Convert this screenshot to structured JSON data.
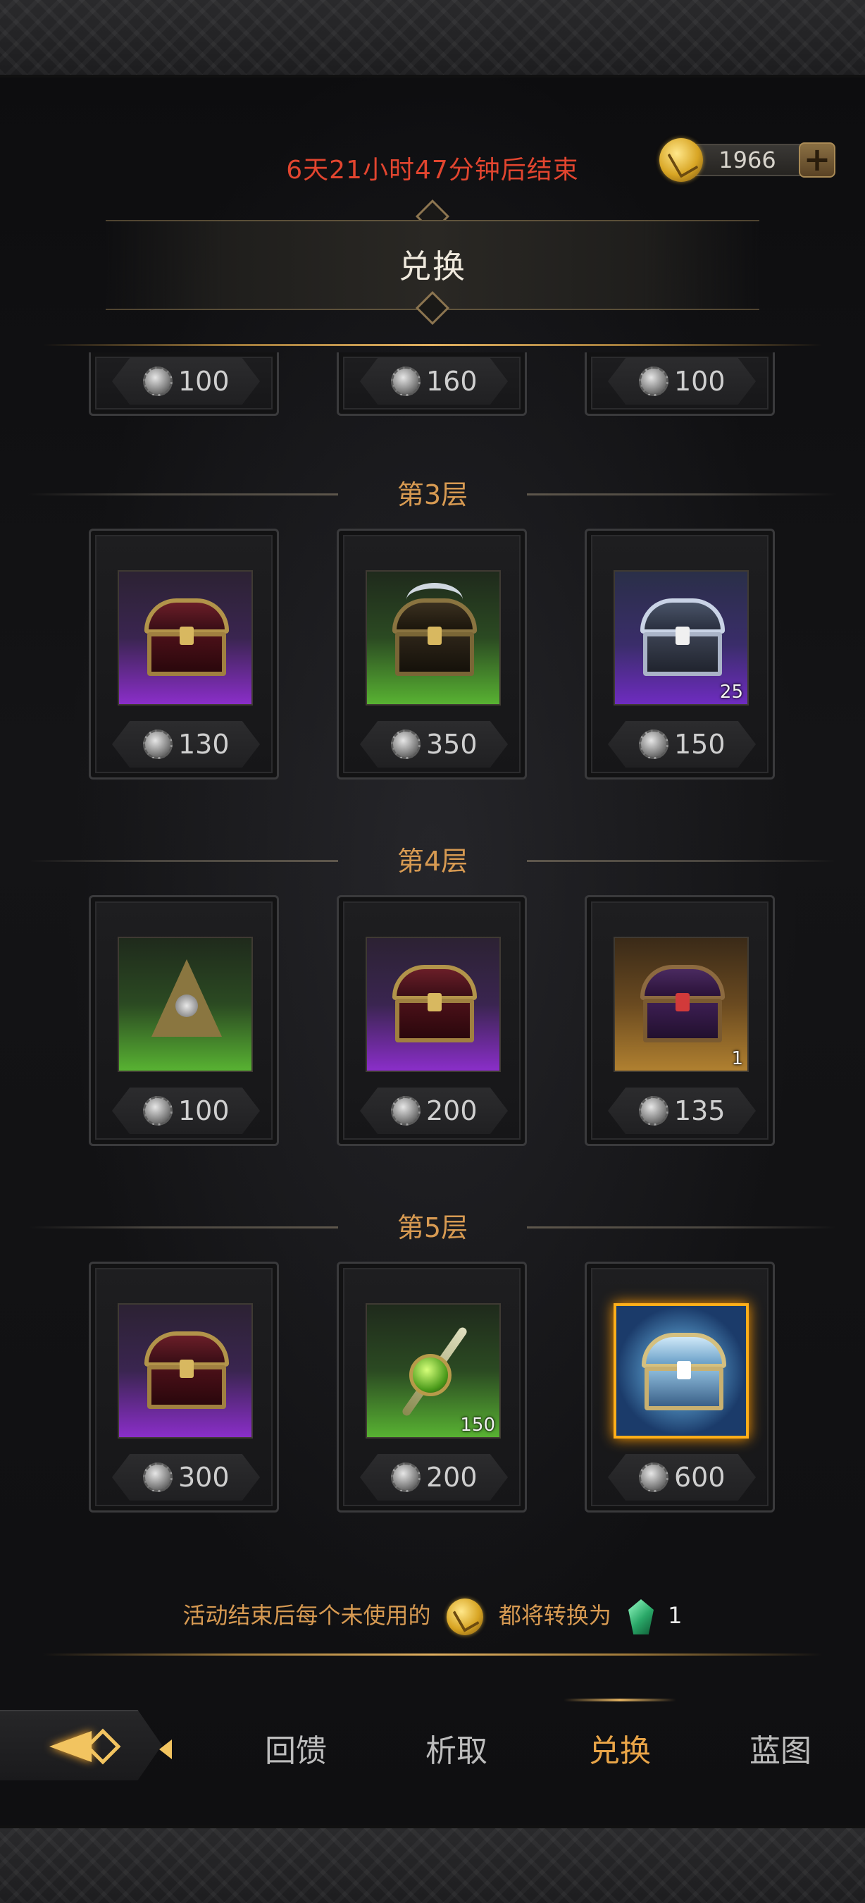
{
  "timer": "6天21小时47分钟后结束",
  "currency": {
    "value": "1966",
    "plus": "+",
    "icon": "gold-coin-icon"
  },
  "header": {
    "title": "兑换"
  },
  "top_row_prices": [
    "100",
    "160",
    "100"
  ],
  "tiers": [
    {
      "label": "第3层",
      "items": [
        {
          "name": "purple-chest",
          "rarity": "purple",
          "price": "130",
          "qty": ""
        },
        {
          "name": "spiky-chest",
          "rarity": "green",
          "price": "350",
          "qty": ""
        },
        {
          "name": "silver-chest",
          "rarity": "purple",
          "price": "150",
          "qty": "25"
        }
      ]
    },
    {
      "label": "第4层",
      "items": [
        {
          "name": "pyramid-relic",
          "rarity": "green",
          "price": "100",
          "qty": ""
        },
        {
          "name": "purple-chest",
          "rarity": "purple",
          "price": "200",
          "qty": ""
        },
        {
          "name": "dark-chest",
          "rarity": "gold",
          "price": "135",
          "qty": "1"
        }
      ]
    },
    {
      "label": "第5层",
      "items": [
        {
          "name": "purple-chest",
          "rarity": "purple",
          "price": "300",
          "qty": ""
        },
        {
          "name": "scepter",
          "rarity": "green",
          "price": "200",
          "qty": "150"
        },
        {
          "name": "ice-chest",
          "rarity": "legend",
          "price": "600",
          "qty": ""
        }
      ]
    }
  ],
  "notice": {
    "before": "活动结束后每个未使用的",
    "after": "都将转换为",
    "count": "1"
  },
  "nav": {
    "tabs": [
      "回馈",
      "析取",
      "兑换",
      "蓝图"
    ],
    "active": "兑换"
  },
  "colors": {
    "accent": "#e9a548",
    "timer": "#e2452f",
    "tier_label": "#d79a52"
  }
}
